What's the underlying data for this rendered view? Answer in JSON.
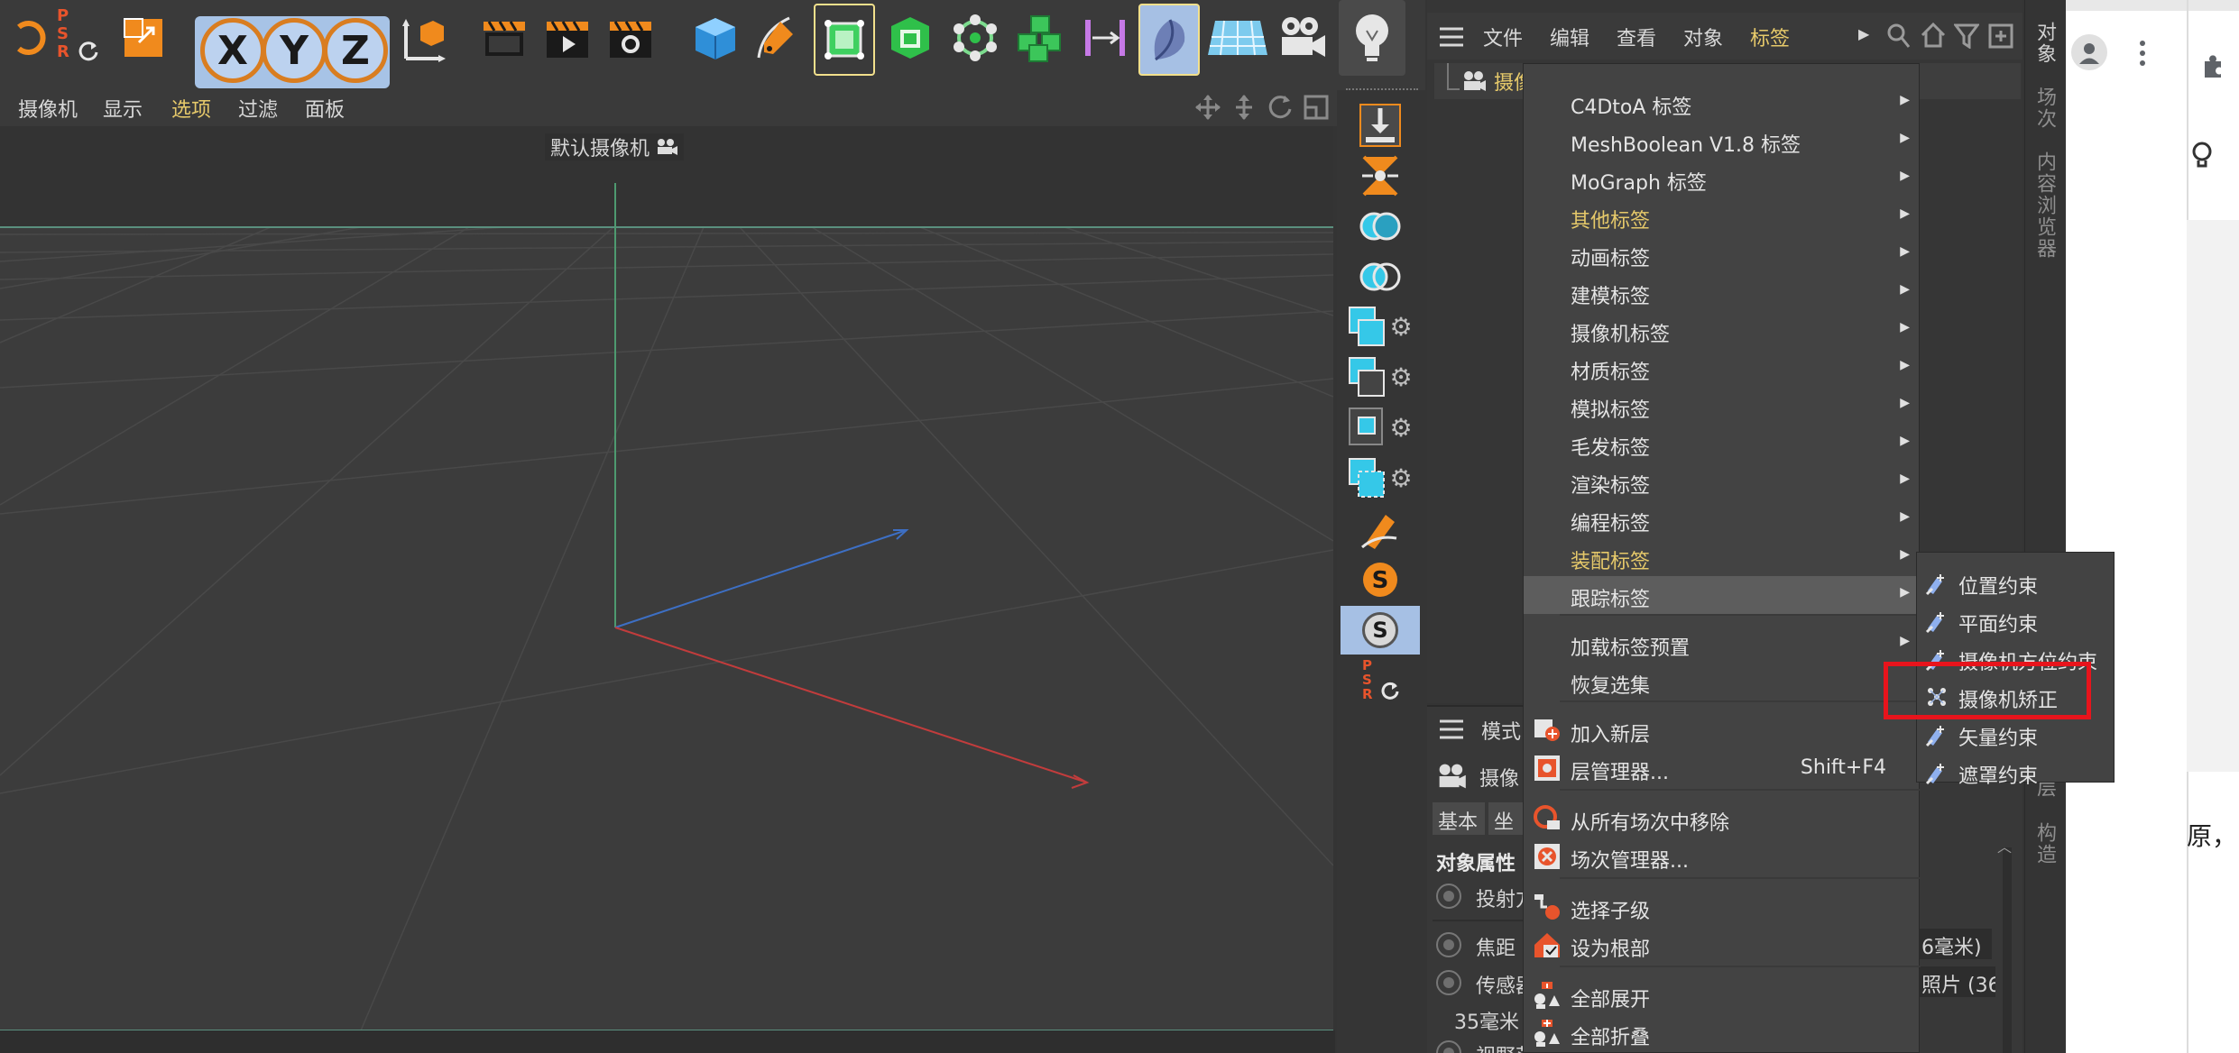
{
  "viewport": {
    "menu": [
      "摄像机",
      "显示",
      "选项",
      "过滤",
      "面板"
    ],
    "active_menu": "选项",
    "camera_label": "默认摄像机"
  },
  "toolbar": {
    "axis_buttons": [
      "X",
      "Y",
      "Z"
    ],
    "psr_letters": [
      "P",
      "S",
      "R"
    ]
  },
  "right_toolbar": {
    "psr_letters": [
      "P",
      "S",
      "R"
    ],
    "s_label": "S"
  },
  "object_manager": {
    "menu": [
      "文件",
      "编辑",
      "查看",
      "对象",
      "标签"
    ],
    "active_menu": "标签",
    "row_label": "摄像"
  },
  "vertical_tabs": {
    "top": [
      "对象",
      "场次",
      "内容浏览器"
    ],
    "bottom": [
      "层",
      "构造"
    ]
  },
  "attributes": {
    "mode_label": "模式",
    "object_label": "摄像",
    "tabs": [
      "基本",
      "坐标"
    ],
    "section": "对象属性",
    "rows": [
      "投射方",
      "焦距",
      "传感器"
    ],
    "lens_value": "35毫米",
    "view_label": "视野范",
    "focal_value": "6毫米)",
    "sensor_value": "照片 (36"
  },
  "tag_menu": {
    "items": [
      {
        "label": "C4DtoA 标签",
        "submenu": true
      },
      {
        "label": "MeshBoolean V1.8 标签",
        "submenu": true
      },
      {
        "label": "MoGraph 标签",
        "submenu": true
      },
      {
        "label": "其他标签",
        "submenu": true,
        "color": "#e6c96a"
      },
      {
        "label": "动画标签",
        "submenu": true
      },
      {
        "label": "建模标签",
        "submenu": true
      },
      {
        "label": "摄像机标签",
        "submenu": true
      },
      {
        "label": "材质标签",
        "submenu": true
      },
      {
        "label": "模拟标签",
        "submenu": true
      },
      {
        "label": "毛发标签",
        "submenu": true
      },
      {
        "label": "渲染标签",
        "submenu": true
      },
      {
        "label": "编程标签",
        "submenu": true
      },
      {
        "label": "装配标签",
        "submenu": true,
        "color": "#e6c96a"
      },
      {
        "label": "跟踪标签",
        "submenu": true,
        "highlighted": true
      },
      {
        "label": "加载标签预置",
        "submenu": true
      },
      {
        "label": "恢复选集",
        "submenu": false
      },
      {
        "label": "加入新层",
        "submenu": false
      },
      {
        "label": "层管理器...",
        "shortcut": "Shift+F4"
      },
      {
        "label": "从所有场次中移除",
        "submenu": false
      },
      {
        "label": "场次管理器...",
        "submenu": false
      },
      {
        "label": "选择子级",
        "submenu": false
      },
      {
        "label": "设为根部",
        "submenu": false
      },
      {
        "label": "全部展开",
        "submenu": false
      },
      {
        "label": "全部折叠",
        "submenu": false
      }
    ]
  },
  "tracking_submenu": {
    "items": [
      "位置约束",
      "平面约束",
      "摄像机方位约束",
      "摄像机矫正",
      "矢量约束",
      "遮罩约束"
    ],
    "highlighted": "摄像机矫正"
  },
  "browser": {
    "right_text": "原，"
  },
  "colors": {
    "accent_yellow": "#e6c96a",
    "highlight_red": "#e8141c",
    "icon_cyan": "#35c8e8",
    "icon_orange": "#f08a1d"
  }
}
